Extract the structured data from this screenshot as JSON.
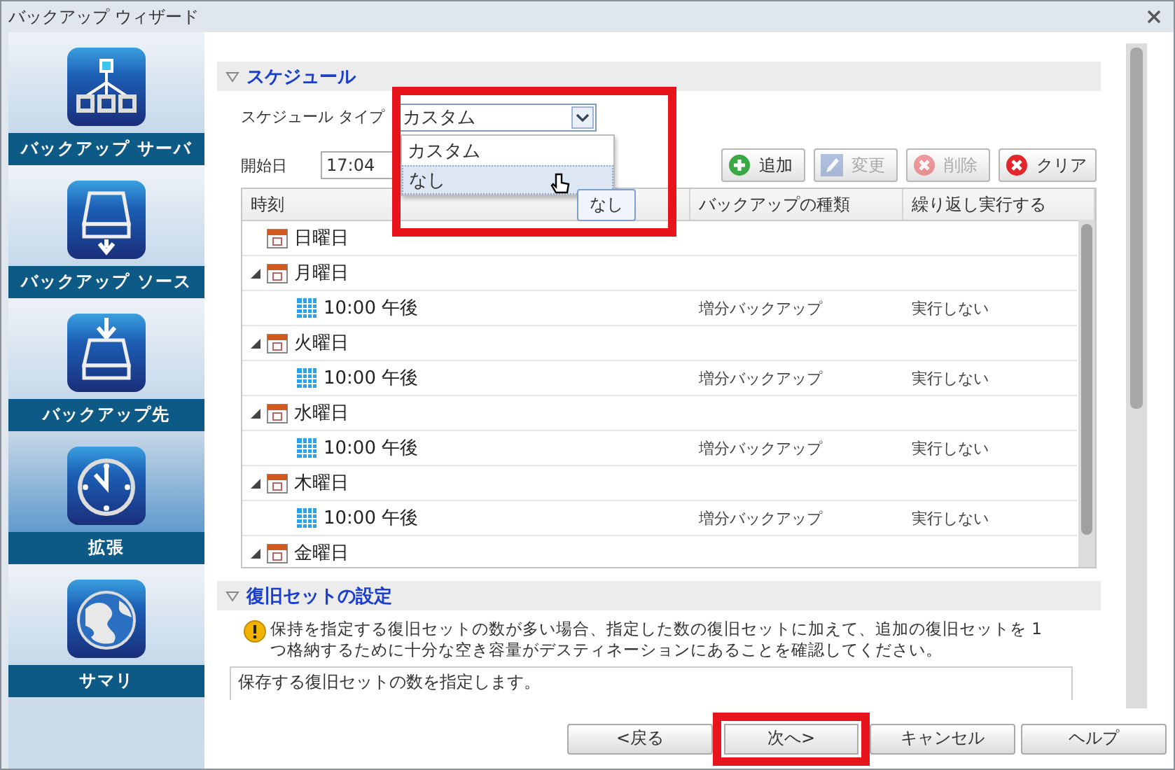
{
  "window": {
    "title": "バックアップ ウィザード"
  },
  "sidebar": {
    "items": [
      {
        "label": "バックアップ サーバ",
        "kind": "server",
        "selected": false
      },
      {
        "label": "バックアップ ソース",
        "kind": "source",
        "selected": false
      },
      {
        "label": "バックアップ先",
        "kind": "destination",
        "selected": false
      },
      {
        "label": "拡張",
        "kind": "clock",
        "selected": true
      },
      {
        "label": "サマリ",
        "kind": "globe",
        "selected": false
      }
    ]
  },
  "schedule": {
    "title": "スケジュール",
    "expanded": true,
    "type_label": "スケジュール タイプ",
    "type_value": "カスタム",
    "highlighted": true,
    "dropdown": {
      "options": [
        {
          "label": "カスタム",
          "hovered": false
        },
        {
          "label": "なし",
          "hovered": true
        }
      ],
      "tooltip": "なし"
    },
    "start_date_label": "開始日",
    "start_date_value": "17:04",
    "toolbar": [
      {
        "label": "追加",
        "kind": "add",
        "disabled": false
      },
      {
        "label": "変更",
        "kind": "edit",
        "disabled": true
      },
      {
        "label": "削除",
        "kind": "delete",
        "disabled": true
      },
      {
        "label": "クリア",
        "kind": "delete",
        "disabled": false
      }
    ],
    "table": {
      "columns": [
        "時刻",
        "バックアップの種類",
        "繰り返し実行する"
      ],
      "rows": [
        {
          "time": "日曜日"
        },
        {
          "time": "月曜日",
          "expanded": true,
          "children": [
            {
              "time": "10:00 午後",
              "type": "増分バックアップ",
              "repeat": "実行しない"
            }
          ]
        },
        {
          "time": "火曜日",
          "expanded": true,
          "children": [
            {
              "time": "10:00 午後",
              "type": "増分バックアップ",
              "repeat": "実行しない"
            }
          ]
        },
        {
          "time": "水曜日",
          "expanded": true,
          "children": [
            {
              "time": "10:00 午後",
              "type": "増分バックアップ",
              "repeat": "実行しない"
            }
          ]
        },
        {
          "time": "木曜日",
          "expanded": true,
          "children": [
            {
              "time": "10:00 午後",
              "type": "増分バックアップ",
              "repeat": "実行しない"
            }
          ]
        },
        {
          "time": "金曜日",
          "expanded": true
        }
      ]
    }
  },
  "recovery_sets": {
    "title": "復旧セットの設定",
    "expanded": true,
    "warning": "保持を指定する復旧セットの数が多い場合、指定した数の復旧セットに加えて、追加の復旧セットを 1 つ格納するために十分な空き容量がデスティネーションにあることを確認してください。",
    "description": "保存する復旧セットの数を指定します。"
  },
  "footer_buttons": [
    {
      "label": "<戻る",
      "highlighted": false
    },
    {
      "label": "次へ>",
      "highlighted": true
    },
    {
      "label": "キャンセル",
      "highlighted": false
    },
    {
      "label": "ヘルプ",
      "highlighted": false
    }
  ]
}
